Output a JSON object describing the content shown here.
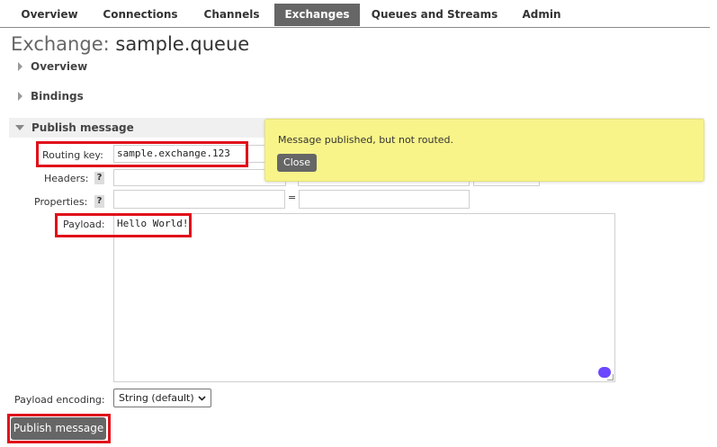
{
  "nav": {
    "tabs": [
      "Overview",
      "Connections",
      "Channels",
      "Exchanges",
      "Queues and Streams",
      "Admin"
    ],
    "active": "Exchanges"
  },
  "page": {
    "title_prefix": "Exchange:",
    "title_name": "sample.queue"
  },
  "sections": {
    "overview": "Overview",
    "bindings": "Bindings",
    "publish": "Publish message"
  },
  "form": {
    "routing_key_label": "Routing key:",
    "routing_key_value": "sample.exchange.123",
    "headers_label": "Headers:",
    "properties_label": "Properties:",
    "help_glyph": "?",
    "equals": "=",
    "payload_label": "Payload:",
    "payload_value": "Hello World!",
    "encoding_label": "Payload encoding:",
    "encoding_value": "String (default)",
    "publish_button": "Publish message"
  },
  "popup": {
    "message": "Message published, but not routed.",
    "close_label": "Close"
  },
  "colors": {
    "active_tab": "#666666",
    "highlight": "#e0101a",
    "popup_bg": "#f8f48a",
    "grammarly": "#6c47ff"
  }
}
